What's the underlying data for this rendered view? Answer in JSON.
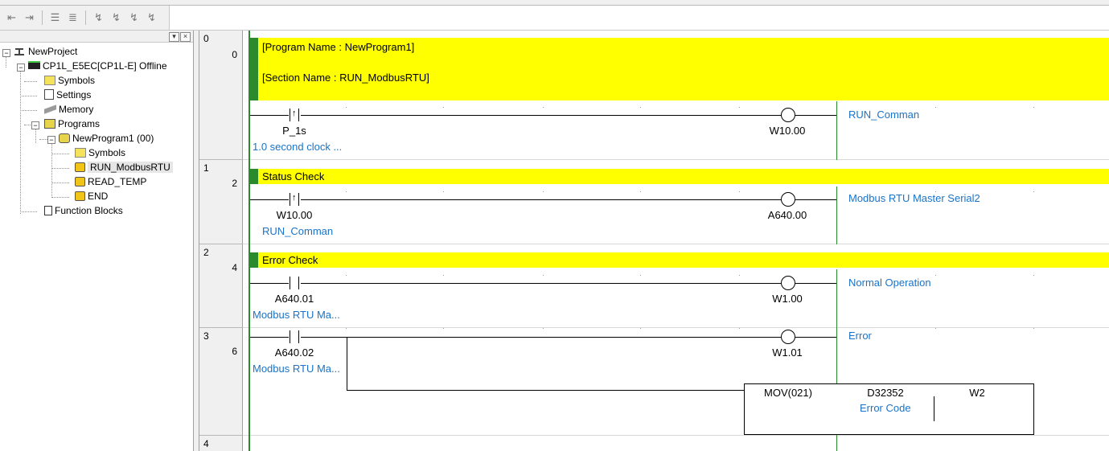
{
  "toolbar": {
    "icons": [
      "indent-left-icon",
      "indent-right-icon",
      "list-icon",
      "list-indent-icon",
      "set-bit-icon",
      "reset-bit-icon",
      "link-icon",
      "unlink-icon"
    ]
  },
  "tree": {
    "project": "NewProject",
    "plc": "CP1L_E5EC[CP1L-E] Offline",
    "symbols": "Symbols",
    "settings": "Settings",
    "memory": "Memory",
    "programs": "Programs",
    "program1": "NewProgram1 (00)",
    "prog_symbols": "Symbols",
    "section_run": "RUN_ModbusRTU",
    "section_read": "READ_TEMP",
    "section_end": "END",
    "function_blocks": "Function Blocks"
  },
  "ladder": {
    "rungs": [
      {
        "rung": "0",
        "step": "0"
      },
      {
        "rung": "1",
        "step": "2"
      },
      {
        "rung": "2",
        "step": "4"
      },
      {
        "rung": "3",
        "step": "6"
      },
      {
        "rung": "4",
        "step": ""
      }
    ],
    "header_banner": {
      "program_name": "[Program Name : NewProgram1]",
      "section_name": "[Section Name : RUN_ModbusRTU]"
    },
    "rung0": {
      "contact": "P_1s",
      "contact_comment": "1.0 second clock ...",
      "coil": "W10.00",
      "coil_comment": "RUN_Comman"
    },
    "rung1": {
      "banner": "Status Check",
      "contact": "W10.00",
      "contact_comment": "RUN_Comman",
      "coil": "A640.00",
      "coil_comment": "Modbus RTU Master Serial2"
    },
    "rung2": {
      "banner": "Error Check",
      "contact": "A640.01",
      "contact_comment": "Modbus RTU Ma...",
      "coil": "W1.00",
      "coil_comment": "Normal Operation"
    },
    "rung3": {
      "contact": "A640.02",
      "contact_comment": "Modbus RTU Ma...",
      "coil": "W1.01",
      "coil_comment": "Error",
      "instr": "MOV(021)",
      "operand1": "D32352",
      "operand1_comment": "Error Code",
      "operand2": "W2"
    }
  },
  "colors": {
    "banner": "#ffff00",
    "rail": "#2b8a2b",
    "comment": "#1a73c8"
  }
}
